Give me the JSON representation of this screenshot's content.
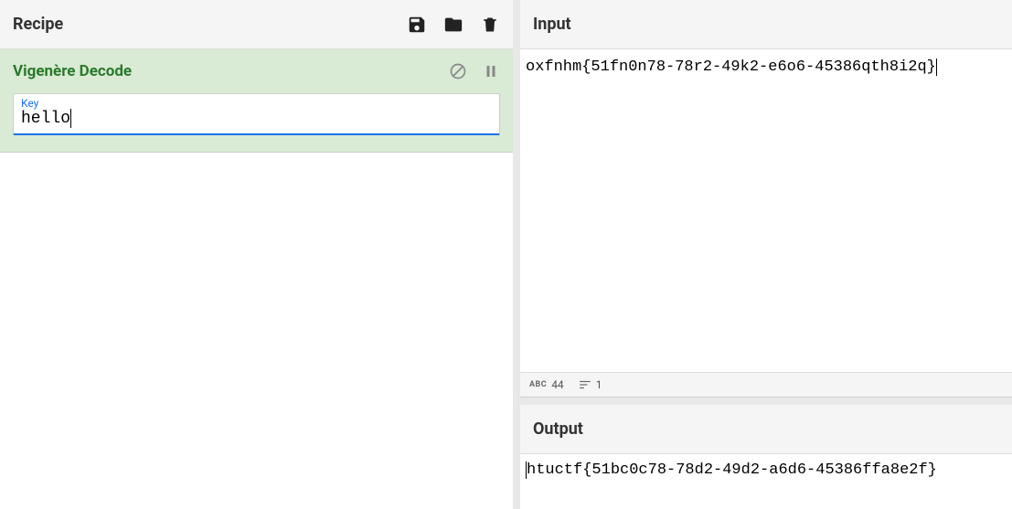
{
  "recipe": {
    "title": "Recipe",
    "operation": {
      "name": "Vigenère Decode",
      "key_label": "Key",
      "key_value": "hello"
    }
  },
  "input": {
    "title": "Input",
    "value": "oxfnhm{51fn0n78-78r2-49k2-e6o6-45386qth8i2q}"
  },
  "status": {
    "char_count": "44",
    "line_count": "1"
  },
  "output": {
    "title": "Output",
    "value": "htuctf{51bc0c78-78d2-49d2-a6d6-45386ffa8e2f}"
  }
}
